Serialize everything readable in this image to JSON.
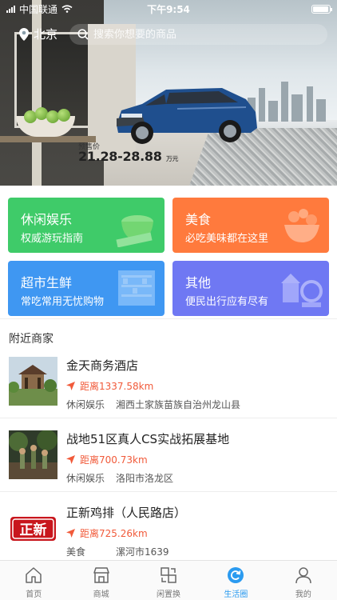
{
  "status_bar": {
    "carrier": "中国联通",
    "time": "下午9:54"
  },
  "header": {
    "city": "北京",
    "search_placeholder": "搜索你想要的商品"
  },
  "banner": {
    "price_label": "预售价",
    "price": "21.28-28.88",
    "price_unit": "万元"
  },
  "categories": [
    {
      "title": "休闲娱乐",
      "subtitle": "权威游玩指南",
      "color": "#3fcb69"
    },
    {
      "title": "美食",
      "subtitle": "必吃美味都在这里",
      "color": "#ff7a3d"
    },
    {
      "title": "超市生鲜",
      "subtitle": "常吃常用无忧购物",
      "color": "#3f97f2"
    },
    {
      "title": "其他",
      "subtitle": "便民出行应有尽有",
      "color": "#6f78f3"
    }
  ],
  "nearby": {
    "title": "附近商家",
    "items": [
      {
        "name": "金天商务酒店",
        "distance": "距离1337.58km",
        "category": "休闲娱乐",
        "address": "湘西土家族苗族自治州龙山县"
      },
      {
        "name": "战地51区真人CS实战拓展基地",
        "distance": "距离700.73km",
        "category": "休闲娱乐",
        "address": "洛阳市洛龙区"
      },
      {
        "name": "正新鸡排（人民路店）",
        "distance": "距离725.26km",
        "category": "美食",
        "address": "漯河市1639",
        "logo_text": "正新"
      }
    ]
  },
  "tabbar": {
    "items": [
      {
        "label": "首页",
        "icon": "home-icon"
      },
      {
        "label": "商城",
        "icon": "store-icon"
      },
      {
        "label": "闲置换",
        "icon": "exchange-icon"
      },
      {
        "label": "生活圈",
        "icon": "life-circle-icon"
      },
      {
        "label": "我的",
        "icon": "user-icon"
      }
    ],
    "active_index": 3,
    "active_color": "#2b9bf0"
  }
}
